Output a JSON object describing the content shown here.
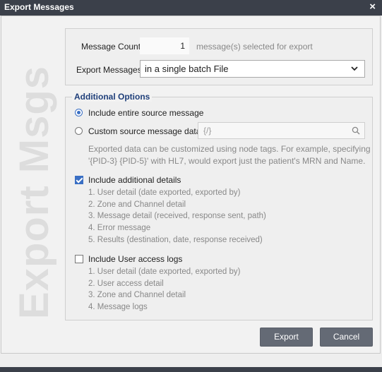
{
  "window": {
    "title": "Export Messages",
    "close_glyph": "×"
  },
  "watermark": "Export Msgs",
  "message_count": {
    "label": "Message Count:",
    "value": "1",
    "suffix": "message(s) selected for export"
  },
  "export_messages": {
    "label": "Export Messages:",
    "selected": "in a single batch File"
  },
  "additional_options": {
    "legend": "Additional Options",
    "include_entire_label": "Include entire source message",
    "custom_source_label": "Custom source message data",
    "custom_source_placeholder": "{/}",
    "description_line1": "Exported data can be customized using node tags. For example, specifying",
    "description_line2": "'{PID-3} {PID-5}' with HL7, would export just the patient's MRN and Name.",
    "include_details_label": "Include additional details",
    "details_items": [
      "1. User detail (date exported, exported by)",
      "2. Zone and Channel detail",
      "3. Message detail (received, response sent, path)",
      "4. Error message",
      "5. Results (destination, date, response received)"
    ],
    "include_logs_label": "Include User access logs",
    "logs_items": [
      "1. User detail (date exported, exported by)",
      "2. User access detail",
      "3. Zone and Channel detail",
      "4. Message logs"
    ]
  },
  "buttons": {
    "export": "Export",
    "cancel": "Cancel"
  },
  "state": {
    "source_mode": "entire",
    "include_additional_details": true,
    "include_user_access_logs": false
  },
  "colors": {
    "titlebar": "#3b404a",
    "accent": "#3a6fc4",
    "legend": "#1f3f7a",
    "button": "#646a75"
  }
}
